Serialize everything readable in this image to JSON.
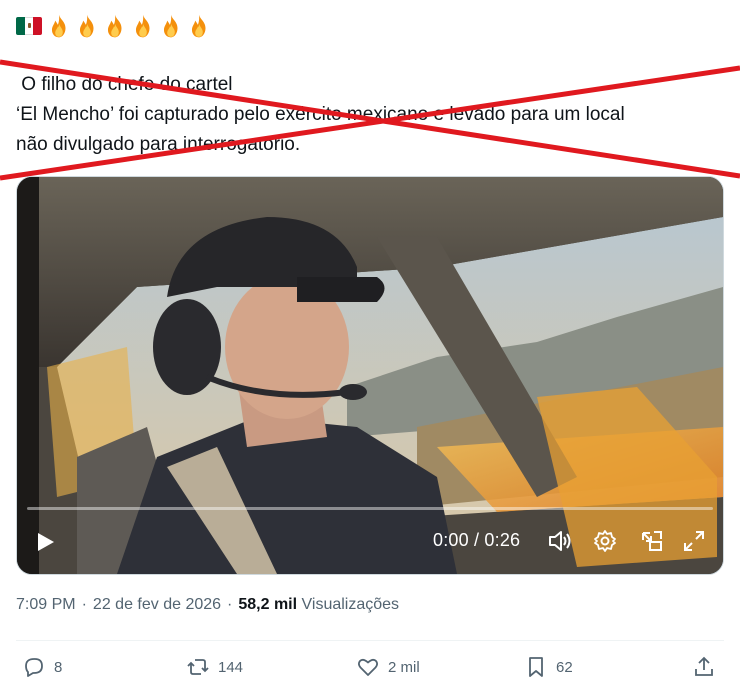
{
  "header": {
    "flag_icon": "mexico-flag-icon",
    "fire_count": 6,
    "fire_icon": "fire-icon"
  },
  "tweet": {
    "lines": [
      " O filho do chefe do cartel",
      "‘El Mencho’ foi capturado pelo exército mexicano e levado para um local",
      "não divulgado para interrogatório."
    ]
  },
  "overlay": {
    "cross_color": "#e0191f"
  },
  "video": {
    "time": "0:00 / 0:26",
    "progress": 0,
    "icons": [
      "play-icon",
      "volume-icon",
      "settings-gear-icon",
      "picture-in-picture-icon",
      "fullscreen-icon"
    ]
  },
  "meta": {
    "time": "7:09 PM",
    "date": "22 de fev de 2026",
    "views_count": "58,2 mil",
    "views_label": "Visualizações"
  },
  "actions": {
    "replies": "8",
    "reposts": "144",
    "likes": "2 mil",
    "bookmarks": "62"
  },
  "colors": {
    "text": "#0f1419",
    "secondary": "#536471",
    "accent_red": "#e0191f"
  }
}
